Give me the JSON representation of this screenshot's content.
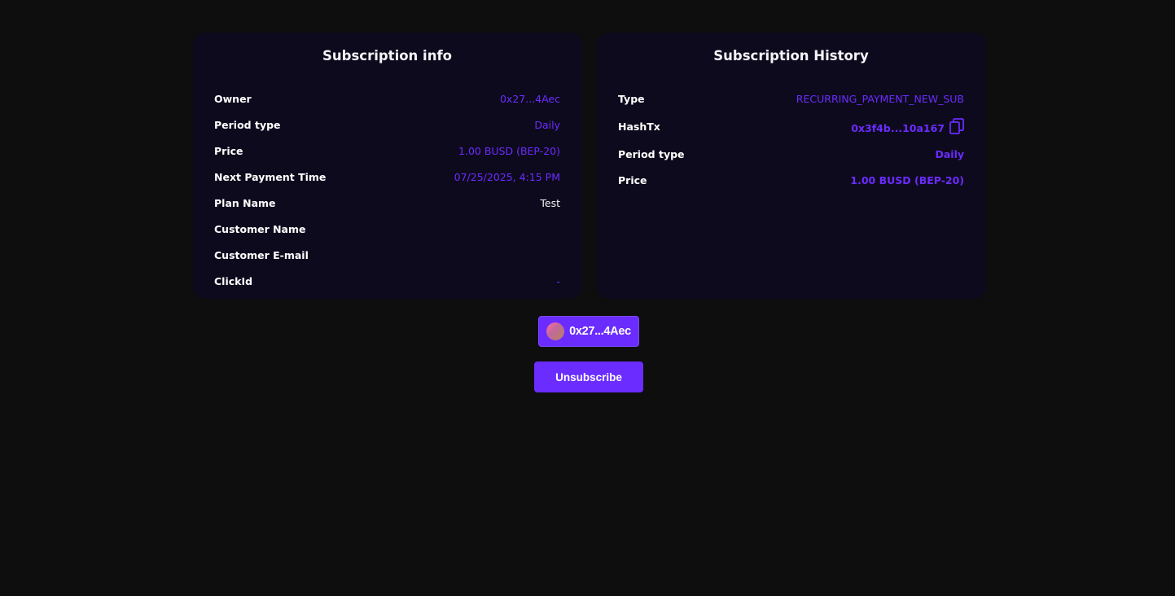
{
  "subscription_info": {
    "title": "Subscription info",
    "rows": [
      {
        "label": "Owner",
        "value": "0x27...4Aec"
      },
      {
        "label": "Period type",
        "value": "Daily"
      },
      {
        "label": "Price",
        "value": "1.00 BUSD (BEP-20)"
      },
      {
        "label": "Next Payment Time",
        "value": "07/25/2025, 4:15 PM"
      },
      {
        "label": "Plan Name",
        "value": "Test"
      },
      {
        "label": "Customer Name",
        "value": ""
      },
      {
        "label": "Customer E-mail",
        "value": ""
      },
      {
        "label": "ClickId",
        "value": "-"
      }
    ]
  },
  "subscription_history": {
    "title": "Subscription History",
    "rows": [
      {
        "label": "Type",
        "value": "RECURRING_PAYMENT_NEW_SUB"
      },
      {
        "label": "HashTx",
        "value": "0x3f4b...10a167",
        "icon": "copy-icon"
      },
      {
        "label": "Period type",
        "value": "Daily"
      },
      {
        "label": "Price",
        "value": "1.00 BUSD (BEP-20)"
      }
    ]
  },
  "wallet": {
    "address": "0x27...4Aec",
    "icon": "avatar"
  },
  "actions": {
    "unsubscribe_label": "Unsubscribe"
  },
  "colors": {
    "accent": "#6a2cff",
    "background": "#0e0e0e",
    "card": "#0e0a1d"
  }
}
